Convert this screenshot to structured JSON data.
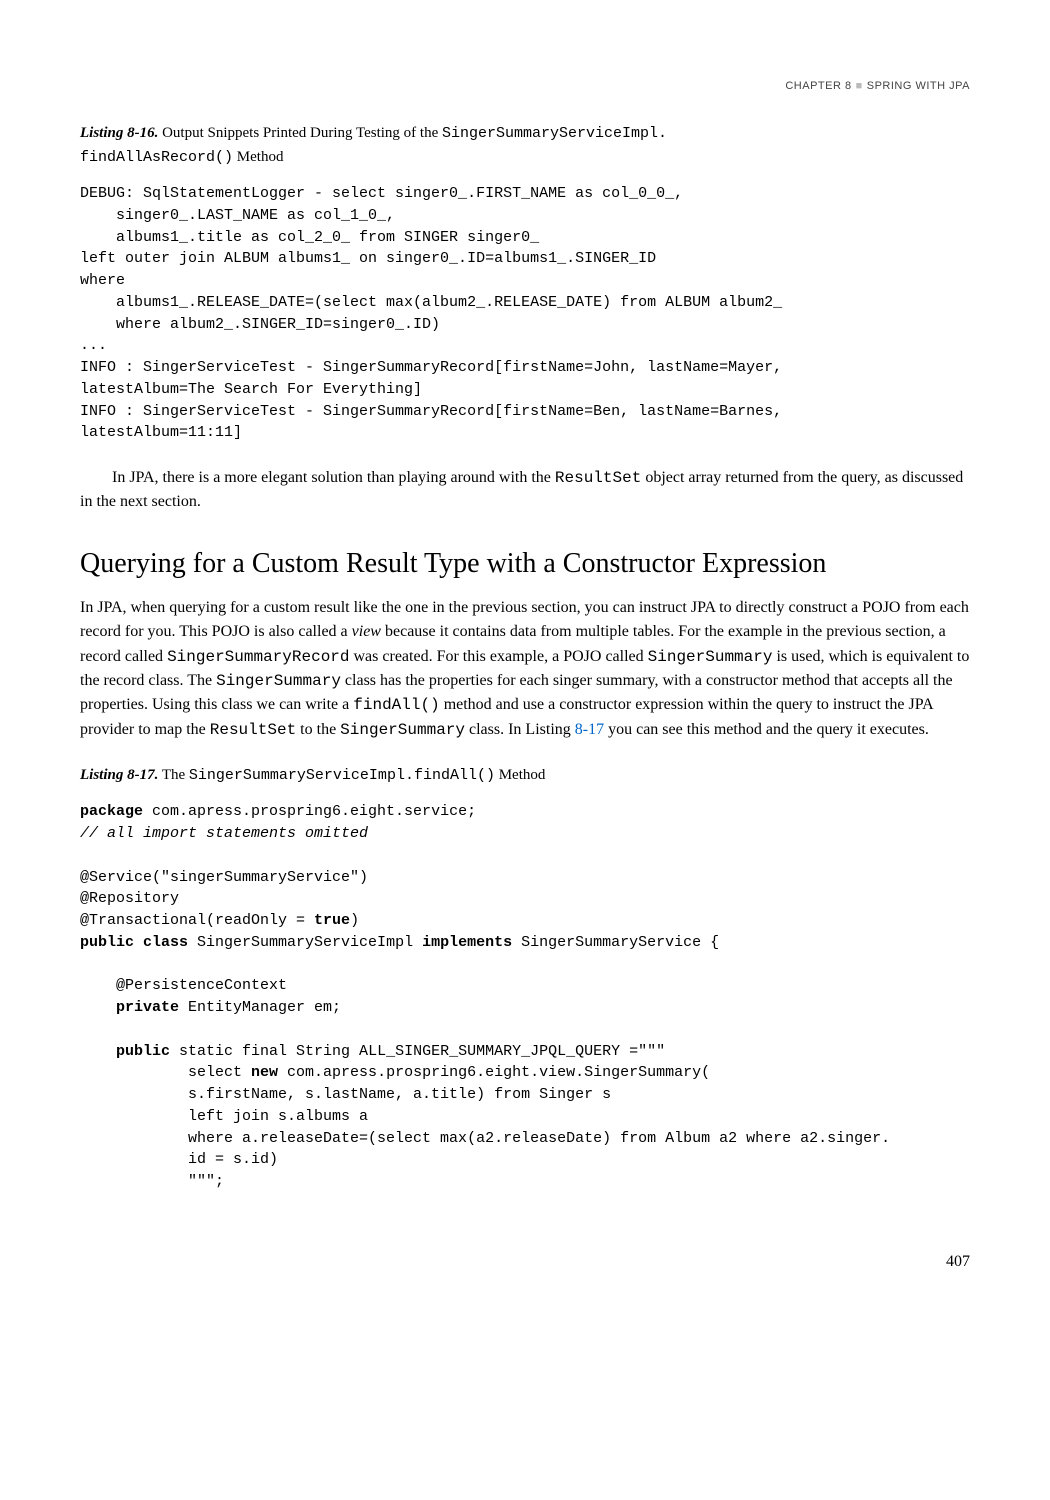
{
  "header": {
    "chapter": "CHAPTER 8",
    "title": "SPRING WITH JPA"
  },
  "listing_8_16": {
    "label": "Listing 8-16.",
    "desc_prefix": "Output Snippets Printed During Testing of the ",
    "desc_mono1": "SingerSummaryServiceImpl.",
    "desc_mono2": "findAllAsRecord()",
    "desc_suffix": " Method",
    "code": "DEBUG: SqlStatementLogger - select singer0_.FIRST_NAME as col_0_0_,\n    singer0_.LAST_NAME as col_1_0_,\n    albums1_.title as col_2_0_ from SINGER singer0_\nleft outer join ALBUM albums1_ on singer0_.ID=albums1_.SINGER_ID\nwhere\n    albums1_.RELEASE_DATE=(select max(album2_.RELEASE_DATE) from ALBUM album2_\n    where album2_.SINGER_ID=singer0_.ID)\n...\nINFO : SingerServiceTest - SingerSummaryRecord[firstName=John, lastName=Mayer,\nlatestAlbum=The Search For Everything]\nINFO : SingerServiceTest - SingerSummaryRecord[firstName=Ben, lastName=Barnes,\nlatestAlbum=11:11]"
  },
  "para1": {
    "t1": "In JPA, there is a more elegant solution than playing around with the ",
    "m1": "ResultSet",
    "t2": " object array returned from the query, as discussed in the next section."
  },
  "section_title": "Querying for a Custom Result Type with a Constructor Expression",
  "section_body": {
    "t1": "In JPA, when querying for a custom result like the one in the previous section, you can instruct JPA to directly construct a POJO from each record for you. This POJO is also called a ",
    "i1": "view",
    "t2": " because it contains data from multiple tables. For the example in the previous section, a record called ",
    "m1": "SingerSummaryRecord",
    "t3": " was created. For this example, a POJO called ",
    "m2": "SingerSummary",
    "t4": " is used, which is equivalent to the record class. The ",
    "m3": "SingerSummary",
    "t5": " class has the properties for each singer summary, with a constructor method that accepts all the properties. Using this class we can write a ",
    "m4": "findAll()",
    "t6": " method and use a constructor expression within the query to instruct the JPA provider to map the ",
    "m5": "ResultSet",
    "t7": " to the ",
    "m6": "SingerSummary",
    "t8": " class. In Listing ",
    "link": "8-17",
    "t9": " you can see this method and the query it executes."
  },
  "listing_8_17": {
    "label": "Listing 8-17.",
    "desc_prefix": "The ",
    "desc_mono": "SingerSummaryServiceImpl.findAll()",
    "desc_suffix": " Method"
  },
  "code2": {
    "kw_package": "package",
    "l1": " com.apress.prospring6.eight.service;",
    "comment": "// all import statements omitted",
    "l3": "@Service(\"singerSummaryService\")",
    "l4": "@Repository",
    "l5a": "@Transactional(readOnly = ",
    "kw_true": "true",
    "l5b": ")",
    "kw_public_class": "public class",
    "l6a": " SingerSummaryServiceImpl ",
    "kw_implements": "implements",
    "l6b": " SingerSummaryService {",
    "l8": "    @PersistenceContext",
    "kw_private": "private",
    "l9": " EntityManager em;",
    "kw_public": "public",
    "l11a": " static final String ALL_SINGER_SUMMARY_JPQL_QUERY =\"\"\"",
    "l12a": "            select ",
    "kw_new": "new",
    "l12b": " com.apress.prospring6.eight.view.SingerSummary(",
    "l13": "            s.firstName, s.lastName, a.title) from Singer s",
    "l14": "            left join s.albums a",
    "l15": "            where a.releaseDate=(select max(a2.releaseDate) from Album a2 where a2.singer.",
    "l16": "            id = s.id)",
    "l17": "            \"\"\";"
  },
  "page_number": "407"
}
